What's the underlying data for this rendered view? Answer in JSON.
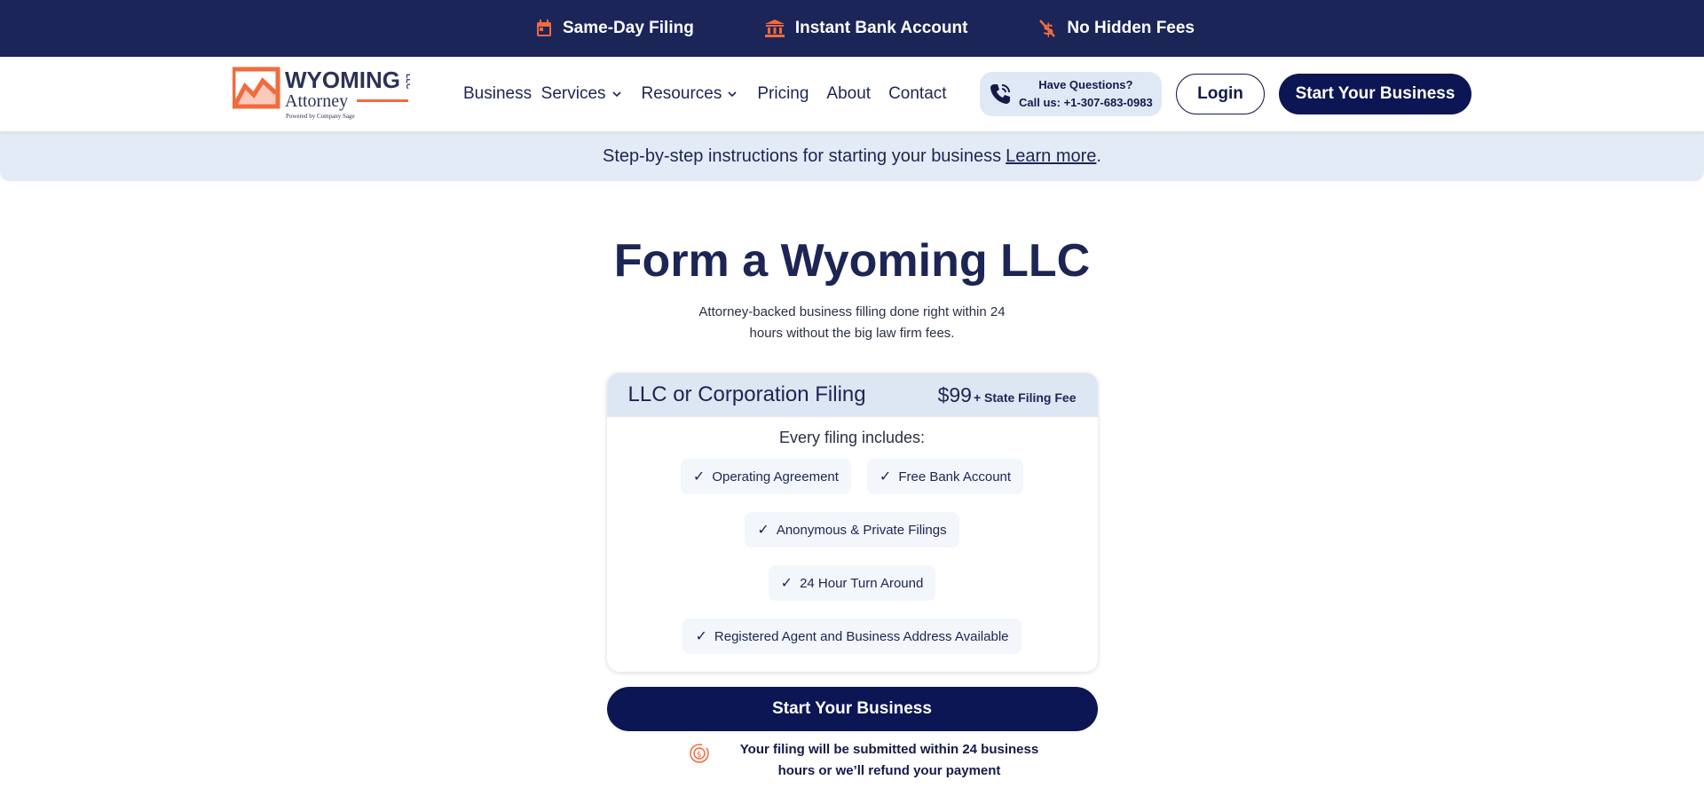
{
  "topbar": {
    "perks": [
      {
        "label": "Same-Day Filing",
        "icon": "calendar-icon"
      },
      {
        "label": "Instant Bank Account",
        "icon": "bank-icon"
      },
      {
        "label": "No Hidden Fees",
        "icon": "no-dollar-icon"
      }
    ],
    "accent_color": "#f26a3d"
  },
  "header": {
    "logo": {
      "line1": "WYOMING",
      "side": "LLC",
      "line2": "Attorney",
      "tagline": "Powered by Company Sage"
    },
    "nav": [
      {
        "label": "Business  Services",
        "has_dropdown": true
      },
      {
        "label": "Resources",
        "has_dropdown": true
      },
      {
        "label": "Pricing",
        "has_dropdown": false
      },
      {
        "label": "About",
        "has_dropdown": false
      },
      {
        "label": "Contact",
        "has_dropdown": false
      }
    ],
    "questions": {
      "line1": "Have Questions?",
      "line2": "Call us: +1-307-683-0983"
    },
    "login_label": "Login",
    "start_label": "Start Your Business"
  },
  "strip": {
    "text": "Step-by-step instructions for starting your business",
    "link": "Learn more",
    "suffix": "."
  },
  "hero": {
    "title": "Form a Wyoming LLC",
    "subtitle": "Attorney-backed business filling done right within 24 hours without the big law firm fees."
  },
  "card": {
    "plan": "LLC or Corporation Filing",
    "price": "$99",
    "price_note": "+ State Filing Fee",
    "includes_label": "Every filing includes:",
    "features": [
      "Operating Agreement",
      "Free Bank Account",
      "Anonymous & Private Filings",
      "24 Hour Turn Around",
      "Registered Agent and Business Address Available"
    ]
  },
  "cta": {
    "label": "Start Your Business"
  },
  "guarantee": {
    "text": "Your filing will be submitted within 24 business hours or we’ll refund your payment"
  },
  "colors": {
    "navy": "#1c2558",
    "button_navy": "#0c1654",
    "light_blue": "#e3ecf6",
    "orange": "#f26a3d"
  }
}
